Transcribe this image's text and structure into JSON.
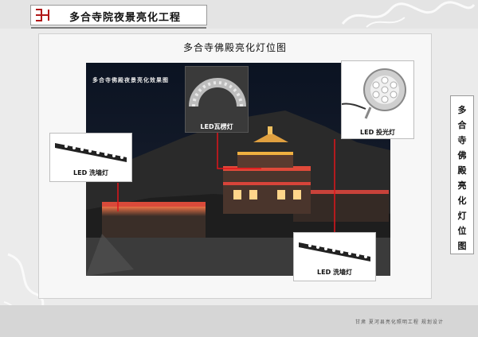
{
  "header": {
    "title": "多合寺院夜景亮化工程"
  },
  "panel": {
    "title": "多合寺佛殿亮化灯位图"
  },
  "photo": {
    "caption": "多合寺佛殿夜景亮化效果图"
  },
  "callouts": {
    "tile_light": "LED瓦楞灯",
    "projector": "LED 投光灯",
    "wash_left": "LED 洗墙灯",
    "wash_right": "LED 洗墙灯"
  },
  "side": {
    "chars": [
      "多",
      "合",
      "寺",
      "佛",
      "殿",
      "亮",
      "化",
      "灯",
      "位",
      "图"
    ]
  },
  "footer": {
    "text": "甘肃 夏河县亮化照明工程 规划设计"
  },
  "colors": {
    "connector": "#e0151b",
    "night_sky": "#0e1524",
    "light_glow": "#ff5a3a"
  }
}
